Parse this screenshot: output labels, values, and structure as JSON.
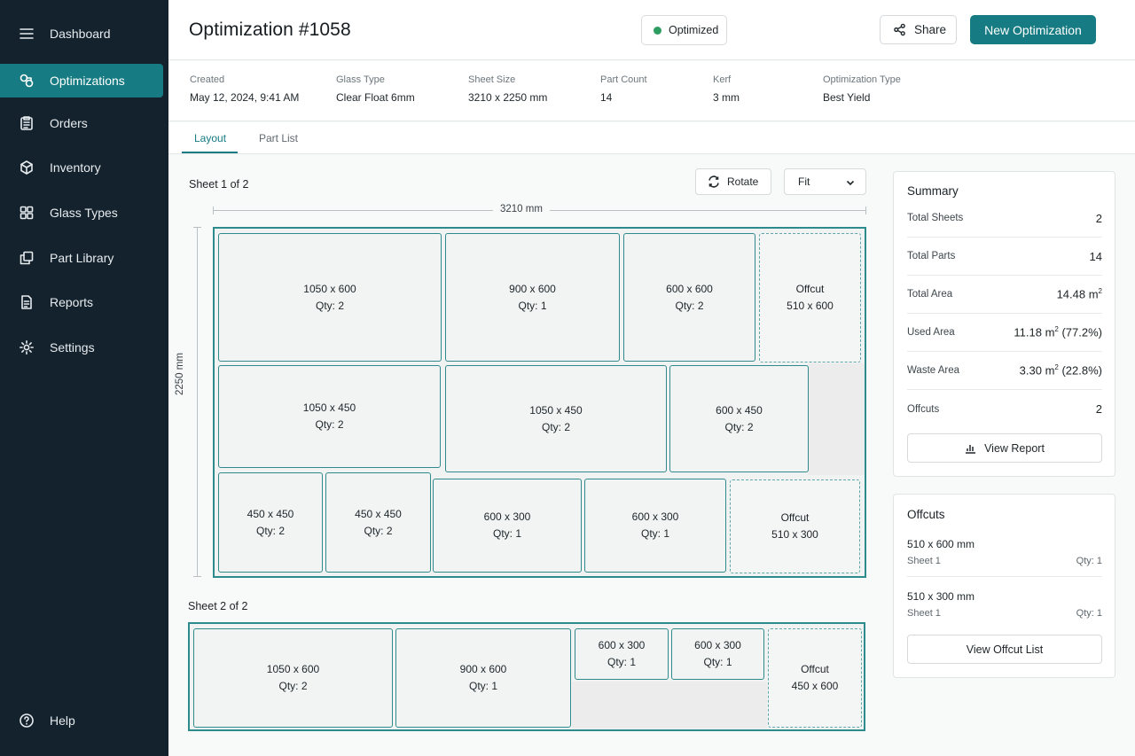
{
  "sidebar": {
    "items": [
      {
        "label": "Dashboard",
        "icon": "menu-icon"
      },
      {
        "label": "Optimizations",
        "icon": "optimizations-icon",
        "active": true
      },
      {
        "label": "Orders",
        "icon": "clipboard-icon"
      },
      {
        "label": "Inventory",
        "icon": "box-icon"
      },
      {
        "label": "Glass Types",
        "icon": "grid-icon"
      },
      {
        "label": "Part Library",
        "icon": "layers-icon"
      },
      {
        "label": "Reports",
        "icon": "document-icon"
      },
      {
        "label": "Settings",
        "icon": "gear-icon"
      }
    ],
    "help": {
      "label": "Help",
      "icon": "help-icon"
    }
  },
  "header": {
    "title": "Optimization #1058",
    "status": "Optimized",
    "share_label": "Share",
    "new_label": "New Optimization"
  },
  "meta": [
    {
      "label": "Created",
      "value": "May 12, 2024, 9:41 AM"
    },
    {
      "label": "Glass Type",
      "value": "Clear Float 6mm"
    },
    {
      "label": "Sheet Size",
      "value": "3210 x 2250 mm"
    },
    {
      "label": "Part Count",
      "value": "14"
    },
    {
      "label": "Kerf",
      "value": "3 mm"
    },
    {
      "label": "Optimization Type",
      "value": "Best Yield"
    }
  ],
  "tabs": [
    "Layout",
    "Part List"
  ],
  "layout": {
    "rotate_label": "Rotate",
    "fit_value": "Fit",
    "width_label": "3210 mm",
    "height_label": "2250 mm",
    "sheet1": {
      "title": "Sheet 1 of 2",
      "parts": [
        {
          "size": "1050 x 600",
          "qty": "Qty: 2"
        },
        {
          "size": "900 x 600",
          "qty": "Qty: 1"
        },
        {
          "size": "600 x 600",
          "qty": "Qty: 2"
        },
        {
          "size": "510 x 600",
          "qty": "Offcut",
          "offcut": true
        },
        {
          "size": "1050 x 450",
          "qty": "Qty: 2"
        },
        {
          "size": "1050 x 450",
          "qty": "Qty: 2"
        },
        {
          "size": "600 x 450",
          "qty": "Qty: 2"
        },
        {
          "size": "450 x 450",
          "qty": "Qty: 2"
        },
        {
          "size": "450 x 450",
          "qty": "Qty: 2"
        },
        {
          "size": "600 x 300",
          "qty": "Qty: 1"
        },
        {
          "size": "600 x 300",
          "qty": "Qty: 1"
        },
        {
          "size": "510 x 300",
          "qty": "Offcut",
          "offcut": true
        }
      ]
    },
    "sheet2": {
      "title": "Sheet 2 of 2",
      "parts": [
        {
          "size": "1050 x 600",
          "qty": "Qty: 2"
        },
        {
          "size": "900 x 600",
          "qty": "Qty: 1"
        },
        {
          "size": "600 x 300",
          "qty": "Qty: 1"
        },
        {
          "size": "600 x 300",
          "qty": "Qty: 1"
        },
        {
          "size": "450 x 600",
          "qty": "Offcut",
          "offcut": true
        }
      ]
    }
  },
  "summary": {
    "title": "Summary",
    "rows": [
      {
        "label": "Total Sheets",
        "value": "2"
      },
      {
        "label": "Total Parts",
        "value": "14"
      },
      {
        "label": "Total Area",
        "value": "14.48 m",
        "sup": "2",
        "after": ""
      },
      {
        "label": "Used Area",
        "value": "11.18 m",
        "sup": "2",
        "after": " (77.2%)"
      },
      {
        "label": "Waste Area",
        "value": "3.30 m",
        "sup": "2",
        "after": " (22.8%)"
      },
      {
        "label": "Offcuts",
        "value": "2"
      }
    ],
    "report_label": "View Report"
  },
  "offcuts": {
    "title": "Offcuts",
    "items": [
      {
        "name": "510 x 600 mm",
        "sheet": "Sheet 1",
        "qty": "Qty: 1"
      },
      {
        "name": "510 x 300 mm",
        "sheet": "Sheet 1",
        "qty": "Qty: 1"
      }
    ],
    "list_label": "View Offcut List"
  },
  "colors": {
    "accent": "#167b82",
    "sidebar": "#14222d",
    "status_ok": "#2e9d62"
  }
}
